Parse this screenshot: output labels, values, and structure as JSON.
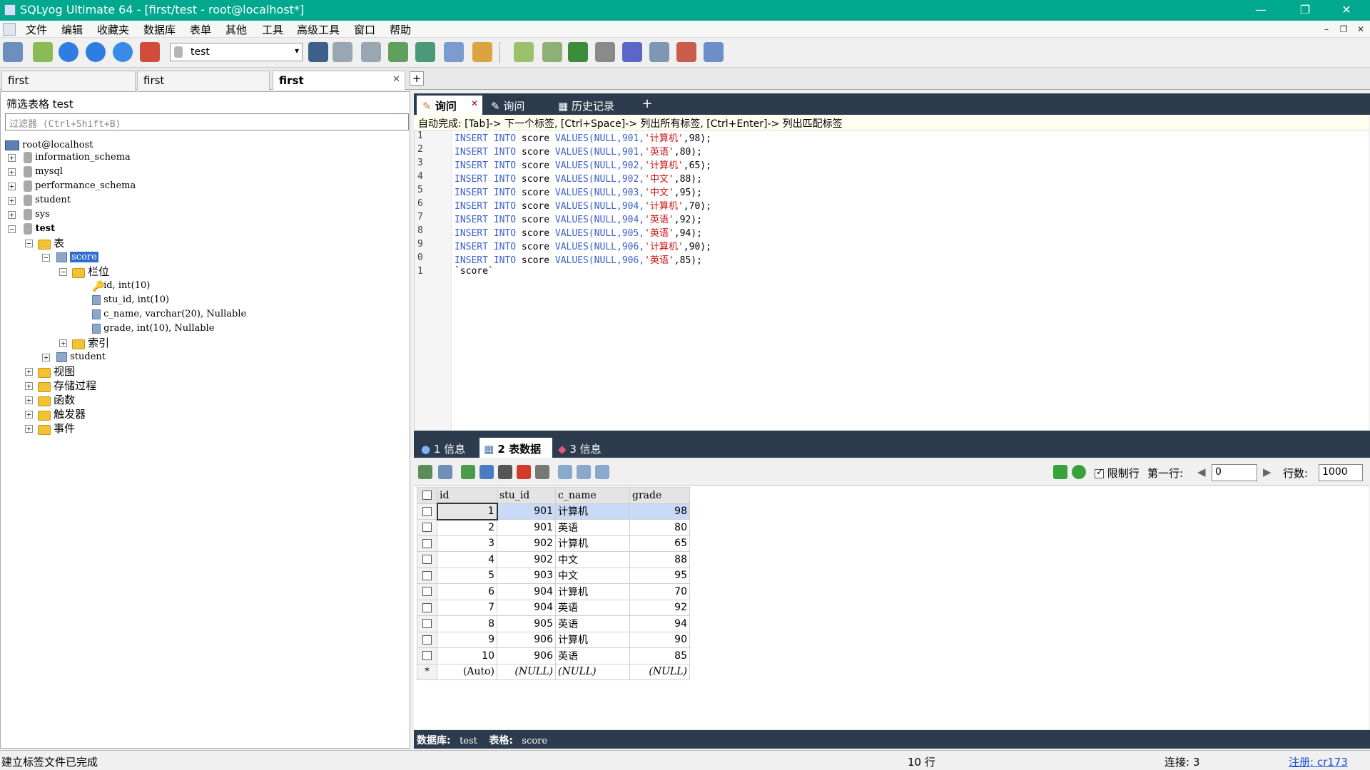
{
  "window": {
    "title": "SQLyog Ultimate 64 - [first/test - root@localhost*]",
    "minimize": "—",
    "restore": "❐",
    "close": "✕"
  },
  "menu": [
    "文件",
    "编辑",
    "收藏夹",
    "数据库",
    "表单",
    "其他",
    "工具",
    "高级工具",
    "窗口",
    "帮助"
  ],
  "toolbar": {
    "db_select_value": "test",
    "dropdown_arrow": "▾"
  },
  "connection_tabs": [
    {
      "label": "first"
    },
    {
      "label": "first"
    },
    {
      "label": "first",
      "close": "✕"
    }
  ],
  "connection_tabs_add": "+",
  "object_browser": {
    "filter_label": "筛选表格 test",
    "filter_placeholder": "过滤器 (Ctrl+Shift+B)",
    "root": "root@localhost",
    "databases": [
      "information_schema",
      "mysql",
      "performance_schema",
      "student",
      "sys",
      "test"
    ],
    "tables_folder": "表",
    "table_score": "score",
    "columns_folder": "栏位",
    "columns": [
      "id, int(10)",
      "stu_id, int(10)",
      "c_name, varchar(20), Nullable",
      "grade, int(10), Nullable"
    ],
    "indexes_folder": "索引",
    "table_student": "student",
    "folders": [
      "视图",
      "存储过程",
      "函数",
      "触发器",
      "事件"
    ]
  },
  "query_tabs": [
    {
      "label": "询问",
      "close": "✕"
    },
    {
      "label": "询问"
    },
    {
      "label": "历史记录"
    }
  ],
  "query_tabs_add": "+",
  "autocomplete_hint": "自动完成: [Tab]-> 下一个标签, [Ctrl+Space]-> 列出所有标签, [Ctrl+Enter]-> 列出匹配标签",
  "editor": {
    "line_numbers": [
      "1",
      "2",
      "3",
      "4",
      "5",
      "6",
      "7",
      "8",
      "9",
      "0",
      "1"
    ],
    "lines": [
      {
        "kw1": "INSERT INTO",
        "tbl": " score ",
        "kw2": "VALUES",
        "pre": "(NULL,901,",
        "str": "'计算机'",
        "post": ",98);"
      },
      {
        "kw1": "INSERT INTO",
        "tbl": " score ",
        "kw2": "VALUES",
        "pre": "(NULL,901,",
        "str": "'英语'",
        "post": ",80);"
      },
      {
        "kw1": "INSERT INTO",
        "tbl": " score ",
        "kw2": "VALUES",
        "pre": "(NULL,902,",
        "str": "'计算机'",
        "post": ",65);"
      },
      {
        "kw1": "INSERT INTO",
        "tbl": " score ",
        "kw2": "VALUES",
        "pre": "(NULL,902,",
        "str": "'中文'",
        "post": ",88);"
      },
      {
        "kw1": "INSERT INTO",
        "tbl": " score ",
        "kw2": "VALUES",
        "pre": "(NULL,903,",
        "str": "'中文'",
        "post": ",95);"
      },
      {
        "kw1": "INSERT INTO",
        "tbl": " score ",
        "kw2": "VALUES",
        "pre": "(NULL,904,",
        "str": "'计算机'",
        "post": ",70);"
      },
      {
        "kw1": "INSERT INTO",
        "tbl": " score ",
        "kw2": "VALUES",
        "pre": "(NULL,904,",
        "str": "'英语'",
        "post": ",92);"
      },
      {
        "kw1": "INSERT INTO",
        "tbl": " score ",
        "kw2": "VALUES",
        "pre": "(NULL,905,",
        "str": "'英语'",
        "post": ",94);"
      },
      {
        "kw1": "INSERT INTO",
        "tbl": " score ",
        "kw2": "VALUES",
        "pre": "(NULL,906,",
        "str": "'计算机'",
        "post": ",90);"
      },
      {
        "kw1": "INSERT INTO",
        "tbl": " score ",
        "kw2": "VALUES",
        "pre": "(NULL,906,",
        "str": "'英语'",
        "post": ",85);"
      }
    ],
    "last_line": "`score`"
  },
  "result_tabs": [
    {
      "label": "1 信息"
    },
    {
      "label": "2 表数据"
    },
    {
      "label": "3 信息"
    }
  ],
  "grid_toolbar": {
    "limit_rows_label": "限制行",
    "first_row_label": "第一行:",
    "first_row_value": "0",
    "rows_label": "行数:",
    "rows_value": "1000",
    "prev": "◀",
    "next": "▶"
  },
  "grid": {
    "columns": [
      "id",
      "stu_id",
      "c_name",
      "grade"
    ],
    "rows": [
      [
        "1",
        "901",
        "计算机",
        "98"
      ],
      [
        "2",
        "901",
        "英语",
        "80"
      ],
      [
        "3",
        "902",
        "计算机",
        "65"
      ],
      [
        "4",
        "902",
        "中文",
        "88"
      ],
      [
        "5",
        "903",
        "中文",
        "95"
      ],
      [
        "6",
        "904",
        "计算机",
        "70"
      ],
      [
        "7",
        "904",
        "英语",
        "92"
      ],
      [
        "8",
        "905",
        "英语",
        "94"
      ],
      [
        "9",
        "906",
        "计算机",
        "90"
      ],
      [
        "10",
        "906",
        "英语",
        "85"
      ]
    ],
    "new_row_marker": "*",
    "new_row": [
      "(Auto)",
      "(NULL)",
      "(NULL)",
      "(NULL)"
    ]
  },
  "right_status": {
    "db_label": "数据库:",
    "db_value": "test",
    "table_label": "表格:",
    "table_value": "score"
  },
  "status_bar": {
    "left": "建立标签文件已完成",
    "rows": "10 行",
    "connections": "连接: 3",
    "register": "注册: cr173"
  },
  "colors": {
    "title_bar": "#00a88e",
    "dark_panel": "#2c3b4d",
    "keyword": "#3a5fcd",
    "string": "#d01010",
    "selection": "#c8daf5"
  }
}
